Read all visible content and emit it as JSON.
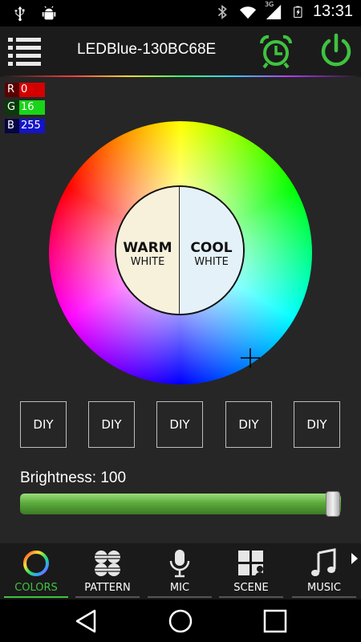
{
  "status_bar": {
    "time": "13:31",
    "network": "3G"
  },
  "app_bar": {
    "title": "LEDBlue-130BC68E"
  },
  "rgb": {
    "r_label": "R",
    "r_value": "0",
    "g_label": "G",
    "g_value": "16",
    "b_label": "B",
    "b_value": "255"
  },
  "white": {
    "warm_title": "WARM",
    "warm_sub": "WHITE",
    "cool_title": "COOL",
    "cool_sub": "WHITE"
  },
  "diy_buttons": [
    "DIY",
    "DIY",
    "DIY",
    "DIY",
    "DIY"
  ],
  "brightness": {
    "label": "Brightness: 100",
    "value_fraction": 1.0
  },
  "tabs": [
    {
      "label": "COLORS",
      "icon": "color-ring-icon",
      "active": true
    },
    {
      "label": "PATTERN",
      "icon": "pattern-dots-icon",
      "active": false
    },
    {
      "label": "MIC",
      "icon": "microphone-icon",
      "active": false
    },
    {
      "label": "SCENE",
      "icon": "scene-grid-icon",
      "active": false
    },
    {
      "label": "MUSIC",
      "icon": "music-note-icon",
      "active": false
    }
  ],
  "colors": {
    "accent": "#3fc33f",
    "background": "#262626"
  }
}
